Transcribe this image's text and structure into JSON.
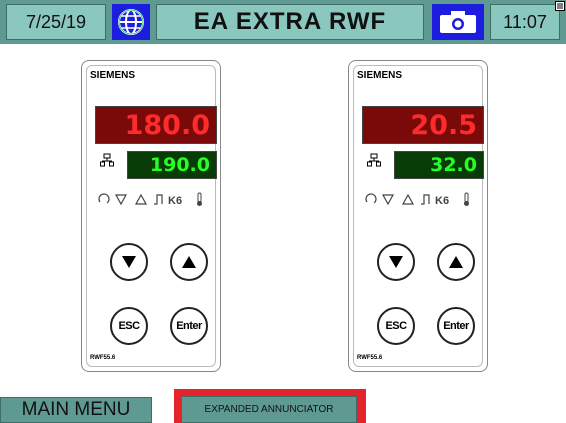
{
  "header": {
    "date": "7/25/19",
    "title": "EA EXTRA RWF",
    "time": "11:07",
    "globe_icon": "globe-icon",
    "camera_icon": "camera-icon"
  },
  "controllers": [
    {
      "brand": "SIEMENS",
      "actual_value": "180.0",
      "setpoint_value": "190.0",
      "esc_label": "ESC",
      "enter_label": "Enter",
      "model": "RWF55.6"
    },
    {
      "brand": "SIEMENS",
      "actual_value": "20.5",
      "setpoint_value": "32.0",
      "esc_label": "ESC",
      "enter_label": "Enter",
      "model": "RWF55.6"
    }
  ],
  "footer": {
    "main_menu_label": "MAIN MENU",
    "expanded_annunciator_label": "EXPANDED ANNUNCIATOR",
    "highlight_color": "#e3242b"
  },
  "colors": {
    "header_bg": "#5f9a92",
    "tile_bg": "#89c7bf",
    "icon_bg": "#1d1de0",
    "actual_display_bg": "#7a0a0a",
    "actual_text": "#ff2b2b",
    "setpoint_display_bg": "#073c07",
    "setpoint_text": "#26ff26"
  }
}
